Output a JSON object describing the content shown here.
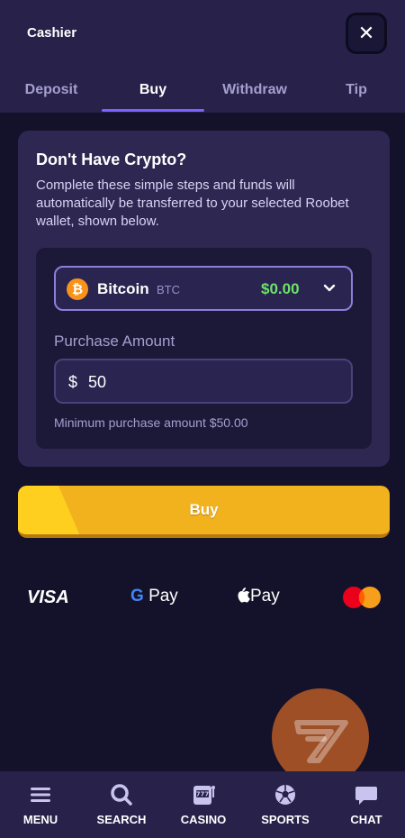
{
  "header": {
    "title": "Cashier",
    "close_icon": "close-icon"
  },
  "tabs": [
    {
      "label": "Deposit",
      "active": false
    },
    {
      "label": "Buy",
      "active": true
    },
    {
      "label": "Withdraw",
      "active": false
    },
    {
      "label": "Tip",
      "active": false
    }
  ],
  "card": {
    "title": "Don't Have Crypto?",
    "description": "Complete these simple steps and funds will automatically be transferred to your selected Roobet wallet, shown below.",
    "coin_select": {
      "icon": "bitcoin-icon",
      "name": "Bitcoin",
      "ticker": "BTC",
      "balance": "$0.00",
      "balance_color": "#6ee16b"
    },
    "amount": {
      "label": "Purchase Amount",
      "currency_symbol": "$",
      "value": "50",
      "min_note": "Minimum purchase amount $50.00"
    }
  },
  "buy_button": {
    "label": "Buy",
    "color": "#f1b21e"
  },
  "payment_methods": {
    "visa": "VISA",
    "gpay_g": "G",
    "gpay_text": "Pay",
    "apple_pay": "Pay"
  },
  "bottom_nav": [
    {
      "label": "MENU",
      "icon": "menu-icon"
    },
    {
      "label": "SEARCH",
      "icon": "search-icon"
    },
    {
      "label": "CASINO",
      "icon": "slot-machine-icon"
    },
    {
      "label": "SPORTS",
      "icon": "soccer-ball-icon"
    },
    {
      "label": "CHAT",
      "icon": "chat-icon"
    }
  ],
  "colors": {
    "accent": "#7b61ff",
    "background": "#14122a",
    "panel": "#28224a"
  }
}
